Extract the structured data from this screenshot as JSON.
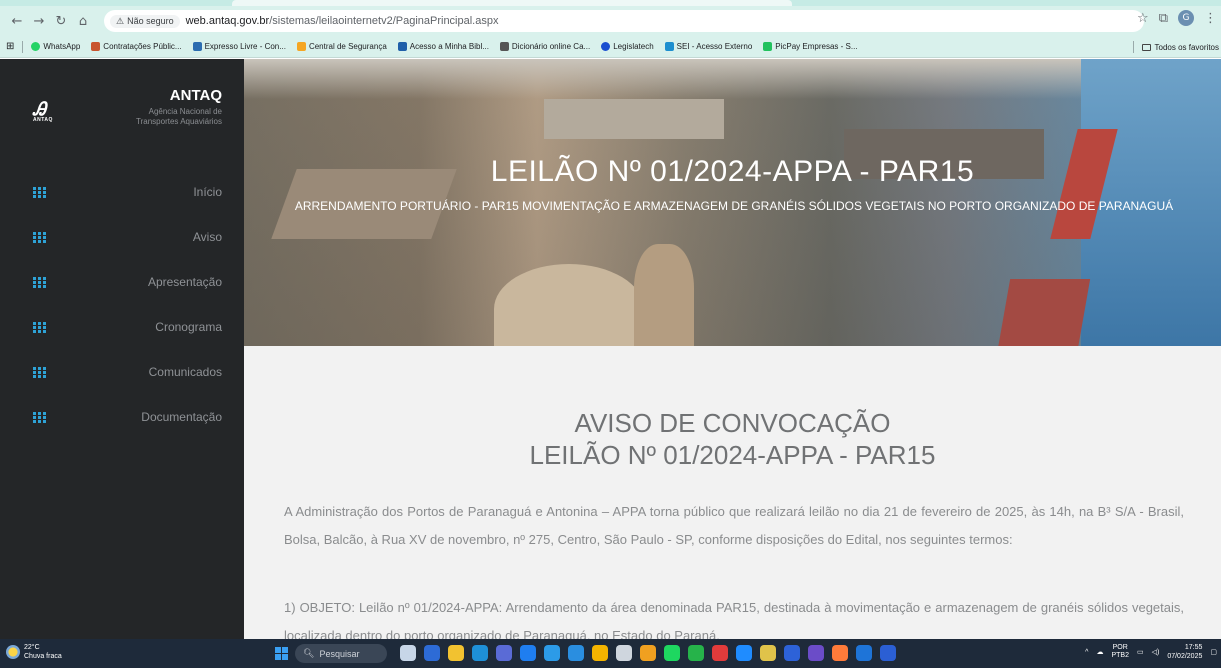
{
  "browser": {
    "security_label": "Não seguro",
    "url_host": "web.antaq.gov.br",
    "url_path": "/sistemas/leilaointernetv2/PaginaPrincipal.aspx",
    "bookmarks": [
      {
        "label": "WhatsApp",
        "color": "#25d366"
      },
      {
        "label": "Contratações Públic...",
        "color": "#c8552f"
      },
      {
        "label": "Expresso Livre - Con...",
        "color": "#2b6cb0"
      },
      {
        "label": "Central de Segurança",
        "color": "#f5a623"
      },
      {
        "label": "Acesso a Minha Bibl...",
        "color": "#1f5fa9"
      },
      {
        "label": "Dicionário online Ca...",
        "color": "#555555"
      },
      {
        "label": "Legislatech",
        "color": "#1a4fd0"
      },
      {
        "label": "SEI - Acesso Externo",
        "color": "#1d8fcf"
      },
      {
        "label": "PicPay Empresas - S...",
        "color": "#21c25e"
      }
    ],
    "all_bookmarks_label": "Todos os favoritos",
    "profile_initial": "G"
  },
  "sidebar": {
    "brand_title": "ANTAQ",
    "brand_sub_line1": "Agência Nacional de",
    "brand_sub_line2": "Transportes Aquaviários",
    "logo_text": "ANTAQ",
    "items": [
      {
        "label": "Início"
      },
      {
        "label": "Aviso"
      },
      {
        "label": "Apresentação"
      },
      {
        "label": "Cronograma"
      },
      {
        "label": "Comunicados"
      },
      {
        "label": "Documentação"
      }
    ]
  },
  "hero": {
    "title": "LEILÃO Nº 01/2024-APPA - PAR15",
    "subtitle": "ARRENDAMENTO PORTUÁRIO - PAR15 MOVIMENTAÇÃO E ARMAZENAGEM DE GRANÉIS SÓLIDOS VEGETAIS NO PORTO ORGANIZADO DE PARANAGUÁ"
  },
  "main": {
    "heading_line1": "AVISO DE CONVOCAÇÃO",
    "heading_line2": "LEILÃO Nº 01/2024-APPA - PAR15",
    "paragraph1": "A Administração dos Portos de Paranaguá e Antonina – APPA torna público que realizará leilão no dia 21 de fevereiro de 2025, às 14h, na B³ S/A - Brasil, Bolsa, Balcão, à Rua XV de novembro, nº 275, Centro, São Paulo - SP, conforme disposições do Edital, nos seguintes termos:",
    "paragraph2": "1) OBJETO: Leilão nº 01/2024-APPA: Arrendamento da área denominada PAR15, destinada à movimentação e armazenagem de granéis sólidos vegetais, localizada dentro do porto organizado de Paranaguá, no Estado do Paraná."
  },
  "taskbar": {
    "temp": "22°C",
    "weather": "Chuva fraca",
    "search_placeholder": "Pesquisar",
    "lang_line1": "POR",
    "lang_line2": "PTB2",
    "time": "17:55",
    "date": "07/02/2025",
    "app_colors": [
      "#c7d6e8",
      "#2d6bd6",
      "#f2c230",
      "#1e90d8",
      "#5a6bd6",
      "#1f7ef0",
      "#2c9be8",
      "#2a8ee0",
      "#f4b400",
      "#cfd6de",
      "#f0a020",
      "#1ed760",
      "#26b34a",
      "#e23b3b",
      "#1f8cff",
      "#e0c34a",
      "#2d62d8",
      "#6b4cc8",
      "#ff7b3a",
      "#1e74d8",
      "#2b5fd4"
    ]
  }
}
